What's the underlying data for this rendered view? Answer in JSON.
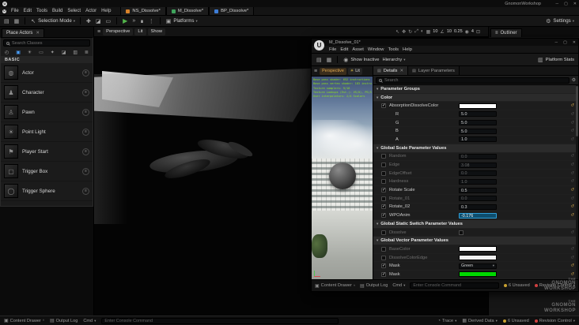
{
  "window": {
    "title": "GnomonWorkshop"
  },
  "menubar": {
    "items": [
      "File",
      "Edit",
      "Tools",
      "Build",
      "Select",
      "Actor",
      "Help"
    ]
  },
  "asset_tabs": [
    {
      "label": "NS_Dissolve*",
      "color": "#d8822a"
    },
    {
      "label": "M_Dissolve*",
      "color": "#3fa45c"
    },
    {
      "label": "BP_Dissolve*",
      "color": "#3e7dd6"
    }
  ],
  "toolbar": {
    "selection_mode": "Selection Mode",
    "platforms": "Platforms",
    "settings": "Settings"
  },
  "viewport": {
    "perspective": "Perspective",
    "lit": "Lit",
    "show": "Show",
    "snap": {
      "grid": "10",
      "angle": "10",
      "scale": "0.25",
      "camera_speed": "4"
    }
  },
  "outliner": {
    "title": "Outliner"
  },
  "place_actors": {
    "title": "Place Actors",
    "search_placeholder": "Search Classes",
    "category": "BASIC",
    "category_icons": [
      "recently-placed-icon",
      "basic-icon",
      "lights-icon",
      "cinematic-icon",
      "visual-effects-icon",
      "geometry-icon",
      "volumes-icon",
      "all-classes-icon"
    ],
    "items": [
      {
        "label": "Actor",
        "icon": "actor-icon"
      },
      {
        "label": "Character",
        "icon": "character-icon"
      },
      {
        "label": "Pawn",
        "icon": "pawn-icon"
      },
      {
        "label": "Point Light",
        "icon": "point-light-icon"
      },
      {
        "label": "Player Start",
        "icon": "player-start-icon"
      },
      {
        "label": "Trigger Box",
        "icon": "trigger-box-icon"
      },
      {
        "label": "Trigger Sphere",
        "icon": "trigger-sphere-icon"
      }
    ]
  },
  "material_editor": {
    "title": "M_Dissolve_01*",
    "menus": [
      "File",
      "Edit",
      "Asset",
      "Window",
      "Tools",
      "Help"
    ],
    "toolbar": {
      "show_inactive": "Show Inactive",
      "hierarchy": "Hierarchy",
      "platform_stats": "Platform Stats"
    },
    "viewport": {
      "perspective": "Perspective",
      "lit": "Lit"
    },
    "stats_lines": [
      "Base pass shader: 652 instructions",
      "Base pass vertex shader: 183 instructions",
      "Texture samplers: 9/16",
      "Texture Lookups (Est.): VS(0), PS(5)",
      "User interpolators: 2/4 Scalars"
    ],
    "tabs": {
      "details": "Details",
      "layer_parameters": "Layer Parameters"
    },
    "search_placeholder": "Search",
    "details": {
      "header": "Parameter Groups",
      "groups": [
        {
          "name": "Color",
          "rows": [
            {
              "label": "AbsorptionDissolveColor",
              "type": "color",
              "swatch": "#ffffff",
              "checked": true
            },
            {
              "label": "R",
              "type": "scalar",
              "value": "5.0",
              "child": true
            },
            {
              "label": "G",
              "type": "scalar",
              "value": "5.0",
              "child": true
            },
            {
              "label": "B",
              "type": "scalar",
              "value": "5.0",
              "child": true
            },
            {
              "label": "A",
              "type": "scalar",
              "value": "1.0",
              "child": true
            }
          ]
        },
        {
          "name": "Global Scale Parameter Values",
          "rows": [
            {
              "label": "Random",
              "type": "scalar",
              "value": "0.0",
              "checked": false
            },
            {
              "label": "Edge",
              "type": "scalar",
              "value": "3.08",
              "checked": false
            },
            {
              "label": "EdgeOffset",
              "type": "scalar",
              "value": "0.0",
              "checked": false
            },
            {
              "label": "Hardness",
              "type": "scalar",
              "value": "1.0",
              "checked": false
            },
            {
              "label": "Rotate Scale",
              "type": "scalar",
              "value": "0.5",
              "checked": true
            },
            {
              "label": "Rotate_01",
              "type": "scalar",
              "value": "0.0",
              "checked": false
            },
            {
              "label": "Rotate_02",
              "type": "scalar",
              "value": "0.3",
              "checked": true
            },
            {
              "label": "WPOAnim",
              "type": "scalar",
              "value": "-0.176",
              "checked": true,
              "selected": true
            }
          ]
        },
        {
          "name": "Global Static Switch Parameter Values",
          "rows": [
            {
              "label": "Dissolve",
              "type": "switch",
              "checked": false
            }
          ]
        },
        {
          "name": "Global Vector Parameter Values",
          "rows": [
            {
              "label": "BaseColor",
              "type": "color",
              "swatch": "#ffffff",
              "checked": false
            },
            {
              "label": "DissolveColorEdge",
              "type": "color",
              "swatch": "#f0f0f0",
              "checked": false
            },
            {
              "label": "Mask",
              "type": "dropdown",
              "value": "Green",
              "checked": true
            },
            {
              "label": "Mask",
              "type": "color",
              "swatch": "#00d800",
              "checked": true
            }
          ]
        }
      ]
    },
    "statusbar": {
      "content_drawer": "Content Drawer",
      "output_log": "Output Log",
      "cmd": "Cmd",
      "console_placeholder": "Enter Console Command",
      "unsaved": "6 Unsaved",
      "revision_control": "Revision Control"
    }
  },
  "statusbar": {
    "content_drawer": "Content Drawer",
    "output_log": "Output Log",
    "cmd": "Cmd",
    "console_placeholder": "Enter Console Command",
    "trace": "Trace",
    "derived_data": "Derived Data",
    "unsaved": "6 Unsaved",
    "revision_control": "Revision Control"
  },
  "watermark": {
    "lines": [
      "THE",
      "GNOMON",
      "WORKSHOP"
    ]
  },
  "colors": {
    "accent": "#26bbff",
    "play_green": "#52b44b",
    "unsaved_amber": "#c8a030",
    "revision_red": "#d04040",
    "mask_green": "#00d800"
  }
}
